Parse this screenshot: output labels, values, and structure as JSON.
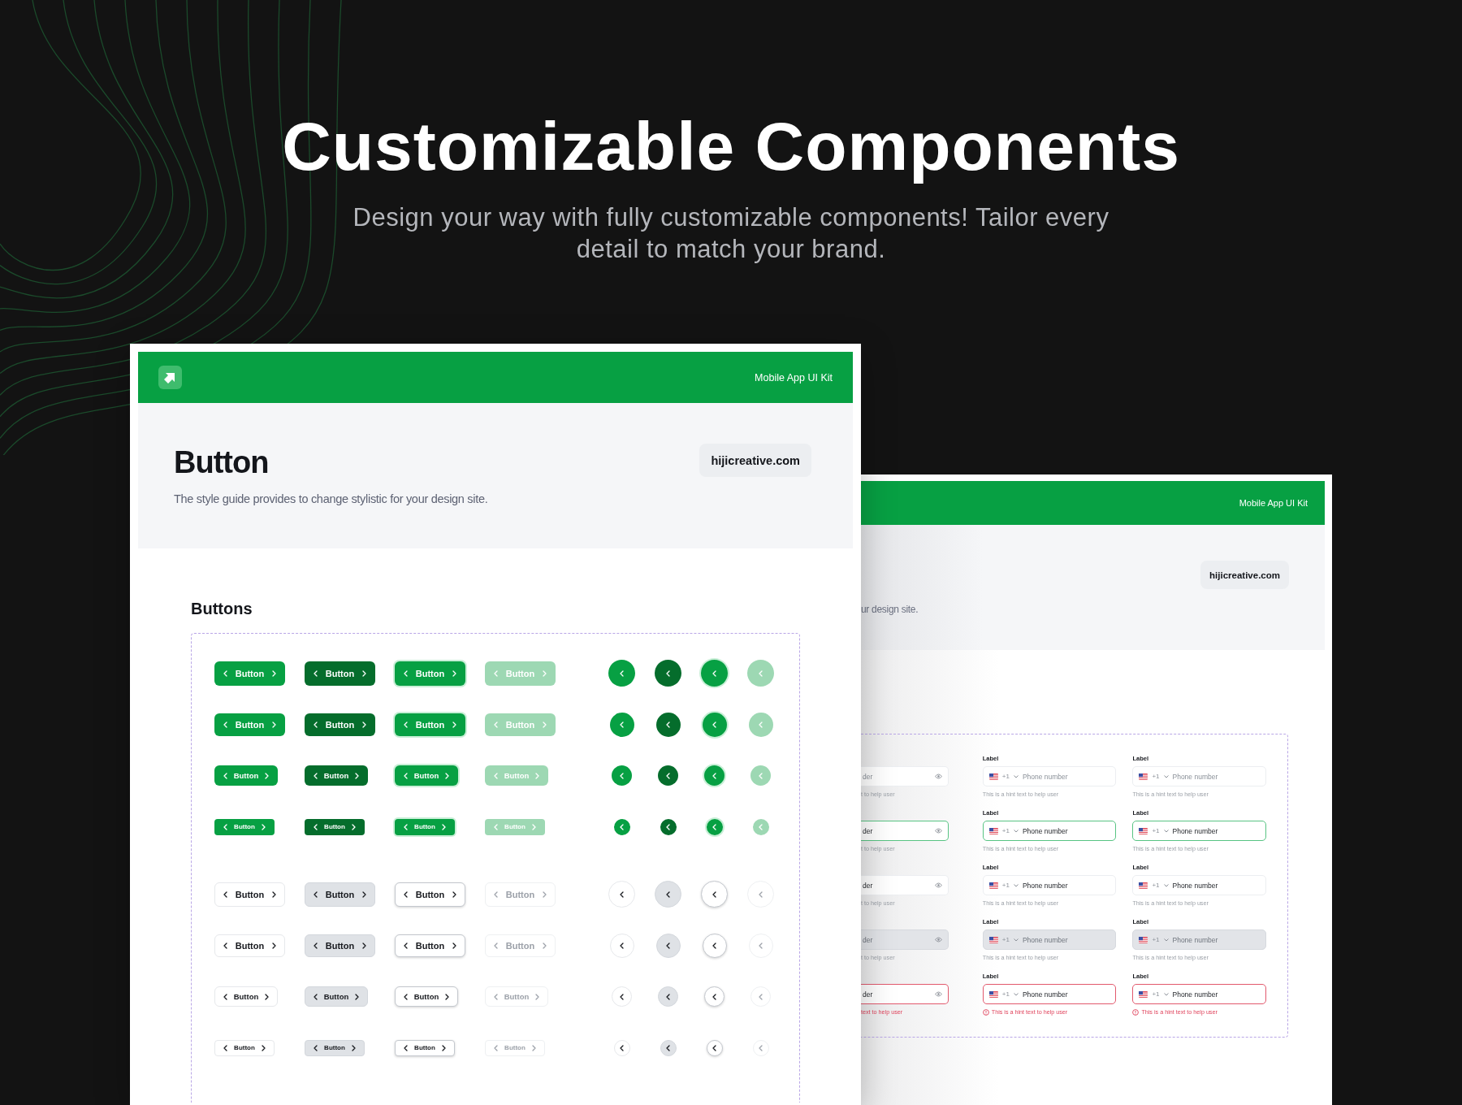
{
  "hero": {
    "title": "Customizable Components",
    "subtitle": "Design your way with fully customizable components! Tailor every detail to match your brand."
  },
  "front_card": {
    "brand": "Mobile App UI Kit",
    "title": "Button",
    "description": "The style guide provides to change stylistic for your design site.",
    "site": "hijicreative.com",
    "section_title": "Buttons",
    "button_rows": [
      {
        "kind": "filled",
        "buttons": [
          {
            "label": "Button",
            "pressed": false,
            "focused": false,
            "disabled": false
          },
          {
            "label": "Button",
            "pressed": true,
            "focused": false,
            "disabled": false
          },
          {
            "label": "Button",
            "pressed": false,
            "focused": true,
            "disabled": false
          },
          {
            "label": "Button",
            "pressed": false,
            "focused": false,
            "disabled": true
          }
        ],
        "icon_buttons": [
          {
            "pressed": false,
            "focused": false,
            "disabled": false
          },
          {
            "pressed": true,
            "focused": false,
            "disabled": false
          },
          {
            "pressed": false,
            "focused": true,
            "disabled": false
          },
          {
            "pressed": false,
            "focused": false,
            "disabled": true
          }
        ]
      },
      {
        "kind": "filled",
        "buttons": [
          {
            "label": "Button",
            "pressed": false,
            "focused": false,
            "disabled": false
          },
          {
            "label": "Button",
            "pressed": true,
            "focused": false,
            "disabled": false
          },
          {
            "label": "Button",
            "pressed": false,
            "focused": true,
            "disabled": false
          },
          {
            "label": "Button",
            "pressed": false,
            "focused": false,
            "disabled": true
          }
        ],
        "icon_buttons": [
          {
            "pressed": false,
            "focused": false,
            "disabled": false
          },
          {
            "pressed": true,
            "focused": false,
            "disabled": false
          },
          {
            "pressed": false,
            "focused": true,
            "disabled": false
          },
          {
            "pressed": false,
            "focused": false,
            "disabled": true
          }
        ]
      },
      {
        "kind": "filled",
        "buttons": [
          {
            "label": "Button",
            "pressed": false,
            "focused": false,
            "disabled": false
          },
          {
            "label": "Button",
            "pressed": true,
            "focused": false,
            "disabled": false
          },
          {
            "label": "Button",
            "pressed": false,
            "focused": true,
            "disabled": false
          },
          {
            "label": "Button",
            "pressed": false,
            "focused": false,
            "disabled": true
          }
        ],
        "icon_buttons": [
          {
            "pressed": false,
            "focused": false,
            "disabled": false
          },
          {
            "pressed": true,
            "focused": false,
            "disabled": false
          },
          {
            "pressed": false,
            "focused": true,
            "disabled": false
          },
          {
            "pressed": false,
            "focused": false,
            "disabled": true
          }
        ]
      },
      {
        "kind": "filled",
        "buttons": [
          {
            "label": "Button",
            "pressed": false,
            "focused": false,
            "disabled": false
          },
          {
            "label": "Button",
            "pressed": true,
            "focused": false,
            "disabled": false
          },
          {
            "label": "Button",
            "pressed": false,
            "focused": true,
            "disabled": false
          },
          {
            "label": "Button",
            "pressed": false,
            "focused": false,
            "disabled": true
          }
        ],
        "icon_buttons": [
          {
            "pressed": false,
            "focused": false,
            "disabled": false
          },
          {
            "pressed": true,
            "focused": false,
            "disabled": false
          },
          {
            "pressed": false,
            "focused": true,
            "disabled": false
          },
          {
            "pressed": false,
            "focused": false,
            "disabled": true
          }
        ]
      },
      {
        "kind": "outline",
        "buttons": [
          {
            "label": "Button",
            "pressed": false,
            "focused": false,
            "disabled": false
          },
          {
            "label": "Button",
            "pressed": true,
            "focused": false,
            "disabled": false
          },
          {
            "label": "Button",
            "pressed": false,
            "focused": true,
            "disabled": false
          },
          {
            "label": "Button",
            "pressed": false,
            "focused": false,
            "disabled": true
          }
        ],
        "icon_buttons": [
          {
            "pressed": false,
            "focused": false,
            "disabled": false
          },
          {
            "pressed": true,
            "focused": false,
            "disabled": false
          },
          {
            "pressed": false,
            "focused": true,
            "disabled": false
          },
          {
            "pressed": false,
            "focused": false,
            "disabled": true
          }
        ]
      },
      {
        "kind": "outline",
        "buttons": [
          {
            "label": "Button",
            "pressed": false,
            "focused": false,
            "disabled": false
          },
          {
            "label": "Button",
            "pressed": true,
            "focused": false,
            "disabled": false
          },
          {
            "label": "Button",
            "pressed": false,
            "focused": true,
            "disabled": false
          },
          {
            "label": "Button",
            "pressed": false,
            "focused": false,
            "disabled": true
          }
        ],
        "icon_buttons": [
          {
            "pressed": false,
            "focused": false,
            "disabled": false
          },
          {
            "pressed": true,
            "focused": false,
            "disabled": false
          },
          {
            "pressed": false,
            "focused": true,
            "disabled": false
          },
          {
            "pressed": false,
            "focused": false,
            "disabled": true
          }
        ]
      },
      {
        "kind": "outline",
        "buttons": [
          {
            "label": "Button",
            "pressed": false,
            "focused": false,
            "disabled": false
          },
          {
            "label": "Button",
            "pressed": true,
            "focused": false,
            "disabled": false
          },
          {
            "label": "Button",
            "pressed": false,
            "focused": true,
            "disabled": false
          },
          {
            "label": "Button",
            "pressed": false,
            "focused": false,
            "disabled": true
          }
        ],
        "icon_buttons": [
          {
            "pressed": false,
            "focused": false,
            "disabled": false
          },
          {
            "pressed": true,
            "focused": false,
            "disabled": false
          },
          {
            "pressed": false,
            "focused": true,
            "disabled": false
          },
          {
            "pressed": false,
            "focused": false,
            "disabled": true
          }
        ]
      },
      {
        "kind": "outline",
        "buttons": [
          {
            "label": "Button",
            "pressed": false,
            "focused": false,
            "disabled": false
          },
          {
            "label": "Button",
            "pressed": true,
            "focused": false,
            "disabled": false
          },
          {
            "label": "Button",
            "pressed": false,
            "focused": true,
            "disabled": false
          },
          {
            "label": "Button",
            "pressed": false,
            "focused": false,
            "disabled": true
          }
        ],
        "icon_buttons": [
          {
            "pressed": false,
            "focused": false,
            "disabled": false
          },
          {
            "pressed": true,
            "focused": false,
            "disabled": false
          },
          {
            "pressed": false,
            "focused": true,
            "disabled": false
          },
          {
            "pressed": false,
            "focused": false,
            "disabled": true
          }
        ]
      }
    ]
  },
  "back_card": {
    "brand": "Mobile App UI Kit",
    "site": "hijicreative.com",
    "description": "ur design site.",
    "input_columns": [
      {
        "kind": "password",
        "fields": [
          {
            "placeholder": "der",
            "hint": "t to help user",
            "focused": false,
            "disabled": false,
            "error": false
          },
          {
            "value": "der",
            "hint": "t to help user",
            "focused": true,
            "disabled": false,
            "error": false
          },
          {
            "value": "der",
            "hint": "t to help user",
            "focused": false,
            "disabled": false,
            "error": false
          },
          {
            "placeholder": "der",
            "hint": "t to help user",
            "focused": false,
            "disabled": true,
            "error": false
          },
          {
            "value": "der",
            "hint": "text to help user",
            "focused": false,
            "disabled": false,
            "error": true
          }
        ]
      },
      {
        "kind": "phone",
        "fields": [
          {
            "label": "Label",
            "code": "+1",
            "placeholder": "Phone number",
            "hint": "This is a hint text to help user",
            "focused": false,
            "disabled": false,
            "error": false
          },
          {
            "label": "Label",
            "code": "+1",
            "value": "Phone number",
            "hint": "This is a hint text to help user",
            "focused": true,
            "disabled": false,
            "error": false
          },
          {
            "label": "Label",
            "code": "+1",
            "value": "Phone number",
            "hint": "This is a hint text to help user",
            "focused": false,
            "disabled": false,
            "error": false
          },
          {
            "label": "Label",
            "code": "+1",
            "placeholder": "Phone number",
            "hint": "This is a hint text to help user",
            "focused": false,
            "disabled": true,
            "error": false
          },
          {
            "label": "Label",
            "code": "+1",
            "value": "Phone number",
            "hint": "This is a hint text to help user",
            "focused": false,
            "disabled": false,
            "error": true
          }
        ]
      },
      {
        "kind": "phone",
        "fields": [
          {
            "label": "Label",
            "code": "+1",
            "placeholder": "Phone number",
            "hint": "This is a hint text to help user",
            "focused": false,
            "disabled": false,
            "error": false
          },
          {
            "label": "Label",
            "code": "+1",
            "value": "Phone number",
            "hint": "This is a hint text to help user",
            "focused": true,
            "disabled": false,
            "error": false
          },
          {
            "label": "Label",
            "code": "+1",
            "value": "Phone number",
            "hint": "This is a hint text to help user",
            "focused": false,
            "disabled": false,
            "error": false
          },
          {
            "label": "Label",
            "code": "+1",
            "placeholder": "Phone number",
            "hint": "This is a hint text to help user",
            "focused": false,
            "disabled": true,
            "error": false
          },
          {
            "label": "Label",
            "code": "+1",
            "value": "Phone number",
            "hint": "This is a hint text to help user",
            "focused": false,
            "disabled": false,
            "error": true
          }
        ]
      }
    ]
  }
}
